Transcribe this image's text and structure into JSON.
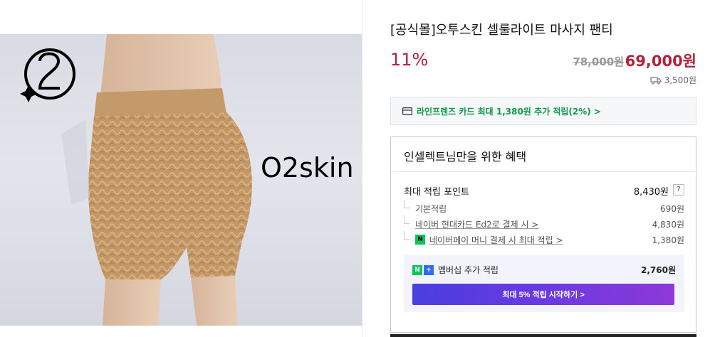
{
  "brand": {
    "name": "O2skin"
  },
  "product": {
    "title": "[공식몰]오투스킨 셀룰라이트 마사지 팬티",
    "discount": "11%",
    "original_price": "78,000원",
    "sale_price": "69,000원",
    "shipping_fee": "3,500원"
  },
  "card_banner": {
    "text": "라인프렌즈 카드 최대 1,380원 추가 적립(2%) >"
  },
  "benefits": {
    "title": "인셀렉트님만을 위한 혜택",
    "max_points_label": "최대 적립 포인트",
    "max_points_value": "8,430원",
    "help": "?",
    "rows": [
      {
        "label": "기본적립",
        "value": "690원"
      },
      {
        "label": "네이버 현대카드 Ed2로 결제 시 >",
        "value": "4,830원"
      },
      {
        "label": "네이버페이 머니 결제 시 최대 적립 >",
        "value": "1,380원",
        "badge": "N"
      }
    ],
    "membership": {
      "badge_n": "N",
      "badge_plus": "+",
      "label": "멤버십 추가 적립",
      "value": "2,760원",
      "button": "최대 5% 적립 시작하기 >"
    }
  },
  "colors": {
    "price_red": "#b3223a",
    "green": "#0f9a4a",
    "button_start": "#4a3ee0",
    "button_end": "#8e39d8"
  }
}
